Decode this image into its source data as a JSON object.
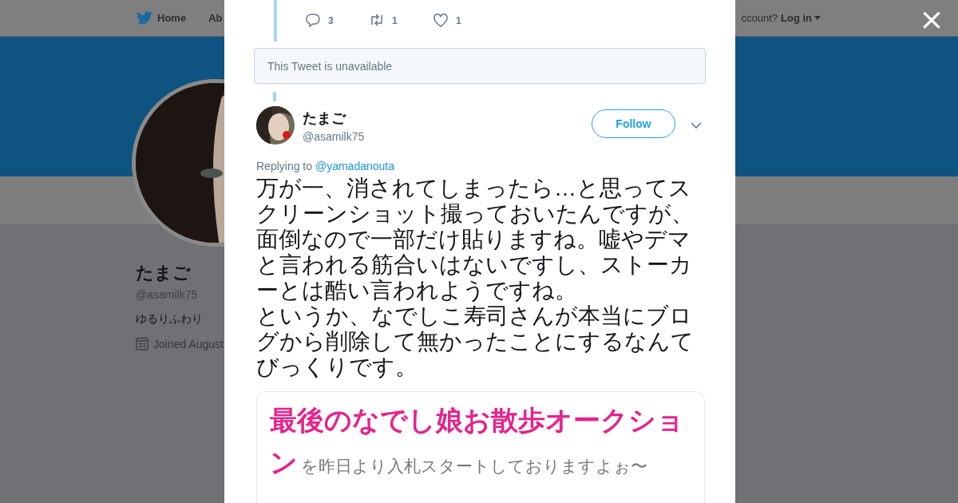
{
  "background_page": {
    "nav": {
      "items": [
        {
          "label": "Home"
        },
        {
          "label": "Ab"
        }
      ],
      "account_prompt": "ccount?",
      "login": "Log in"
    },
    "profile": {
      "name": "たまご",
      "handle": "@asamilk75",
      "bio": "ゆるりふわり",
      "joined": "Joined August"
    }
  },
  "modal": {
    "close": "×",
    "previous_tweet": {
      "actions": [
        {
          "kind": "reply",
          "count": "3"
        },
        {
          "kind": "retweet",
          "count": "1"
        },
        {
          "kind": "like",
          "count": "1"
        }
      ]
    },
    "unavailable_notice": "This Tweet is unavailable",
    "tweet": {
      "name": "たまご",
      "handle": "@asamilk75",
      "follow": "Follow",
      "replying_to": "Replying to",
      "reply_handle": "@yamadanouta",
      "paragraphs": [
        "万が一、消されてしまったら…と思ってスクリーンショット撮っておいたんですが、面倒なので一部だけ貼りますね。嘘やデマと言われる筋合いはないですし、ストーカーとは酷い言われようですね。",
        "というか、なでしこ寿司さんが本当にブログから削除して無かったことにするなんてびっくりです。"
      ],
      "attachment": {
        "title": "最後のなでし娘お散歩オークション",
        "subtitle": "を昨日より入札スタートしておりますよぉ〜"
      }
    }
  }
}
